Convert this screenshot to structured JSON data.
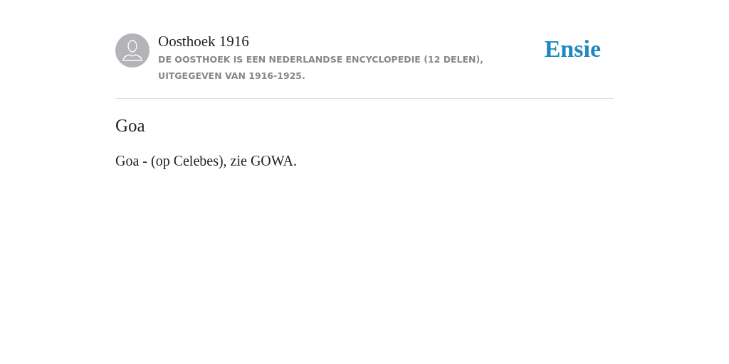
{
  "source": {
    "title": "Oosthoek 1916",
    "description": "DE OOSTHOEK IS EEN NEDERLANDSE ENCYCLOPEDIE (12 DELEN), UITGEGEVEN VAN 1916-1925."
  },
  "logo": "Ensie",
  "article": {
    "heading": "Goa",
    "body": "Goa - (op Celebes), zie GOWA."
  }
}
